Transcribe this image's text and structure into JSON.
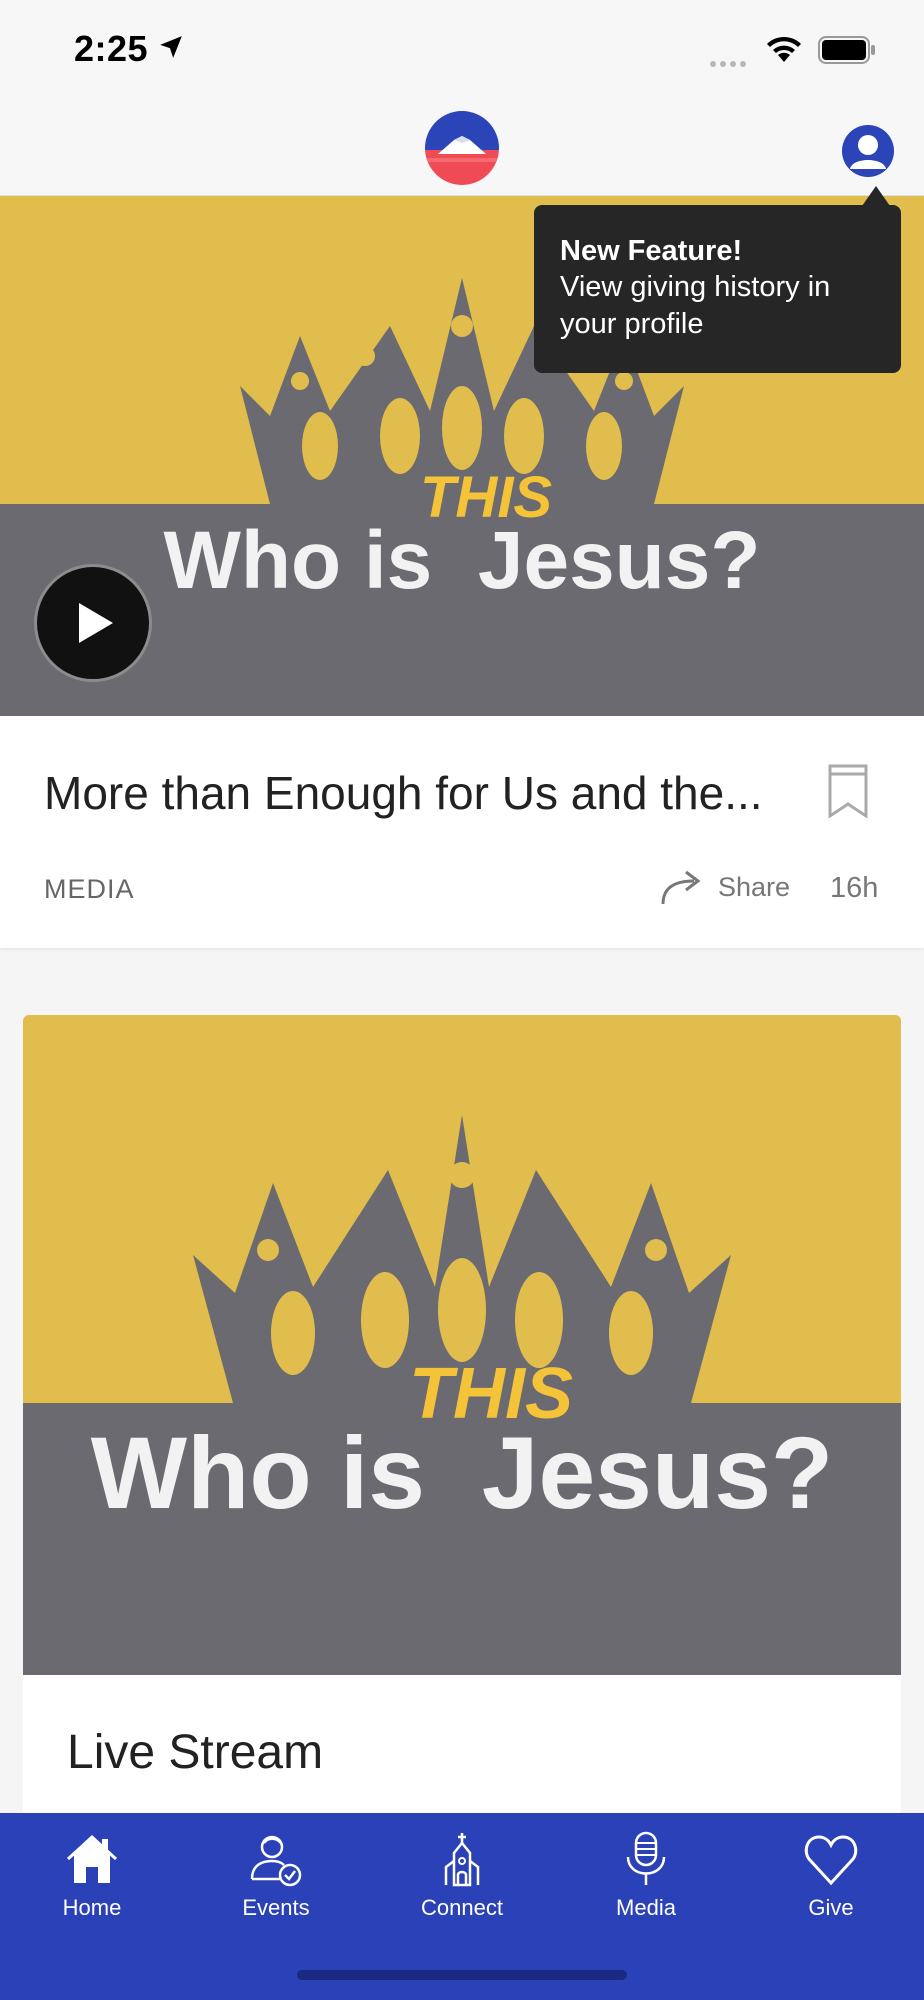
{
  "status_bar": {
    "time": "2:25"
  },
  "header": {
    "logo": "church-logo",
    "profile": "profile-icon"
  },
  "tooltip": {
    "title": "New Feature!",
    "body": "View giving history in your profile"
  },
  "feed": {
    "items": [
      {
        "art": {
          "title_left": "Who is",
          "title_right": "Jesus?",
          "insert": "THIS"
        },
        "title": "More than Enough for Us and the...",
        "tag": "MEDIA",
        "share_label": "Share",
        "time": "16h"
      },
      {
        "art": {
          "title_left": "Who is",
          "title_right": "Jesus?",
          "insert": "THIS"
        },
        "title": "Live Stream"
      }
    ]
  },
  "tabs": [
    {
      "label": "Home",
      "icon": "home-icon"
    },
    {
      "label": "Events",
      "icon": "events-icon"
    },
    {
      "label": "Connect",
      "icon": "church-icon"
    },
    {
      "label": "Media",
      "icon": "microphone-icon"
    },
    {
      "label": "Give",
      "icon": "heart-icon"
    }
  ],
  "colors": {
    "accent": "#2a41b8",
    "art_yellow": "#e0bd4d",
    "art_gray": "#6b6a70",
    "tooltip_bg": "#262626"
  }
}
